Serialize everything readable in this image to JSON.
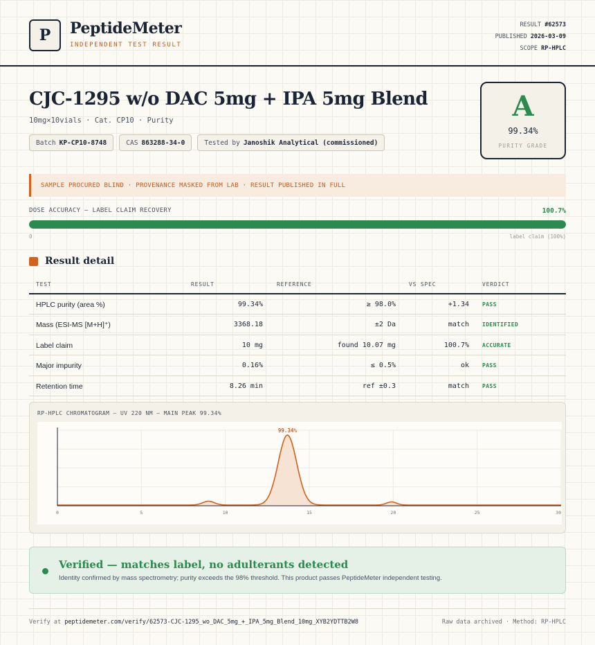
{
  "brand": {
    "logo_letter": "P",
    "name": "PeptideMeter",
    "tagline": "INDEPENDENT TEST RESULT"
  },
  "meta": {
    "result_label": "RESULT",
    "result_value": "#62573",
    "published_label": "PUBLISHED",
    "published_value": "2026-03-09",
    "scope_label": "SCOPE",
    "scope_value": "RP-HPLC"
  },
  "product": {
    "title": "CJC-1295 w/o DAC 5mg + IPA 5mg Blend",
    "subtitle": "10mg×10vials · Cat. CP10 · Purity",
    "chips": {
      "batch_label": "Batch",
      "batch_value": "KP-CP10-8748",
      "cas_label": "CAS",
      "cas_value": "863288-34-0",
      "tested_label": "Tested by",
      "tested_value": "Janoshik Analytical (commissioned)"
    }
  },
  "grade": {
    "letter": "A",
    "value": "99.34%",
    "label": "PURITY GRADE",
    "color": "#2b8a4e"
  },
  "notice": "SAMPLE PROCURED BLIND · PROVENANCE MASKED FROM LAB · RESULT PUBLISHED IN FULL",
  "dose": {
    "label": "DOSE ACCURACY — LABEL CLAIM RECOVERY",
    "value": "100.7%",
    "fill_fraction": 1.0,
    "min_label": "0",
    "max_label": "label claim (100%)"
  },
  "section_title": "Result detail",
  "table": {
    "headers": {
      "test": "TEST",
      "result": "RESULT",
      "reference": "REFERENCE",
      "vs_spec": "VS SPEC",
      "verdict": "VERDICT"
    },
    "rows": [
      {
        "test": "HPLC purity (area %)",
        "result": "99.34%",
        "reference": "≥ 98.0%",
        "vs_spec": "+1.34",
        "verdict": "PASS"
      },
      {
        "test": "Mass (ESI-MS [M+H]⁺)",
        "result": "3368.18",
        "reference": "±2 Da",
        "vs_spec": "match",
        "verdict": "IDENTIFIED"
      },
      {
        "test": "Label claim",
        "result": "10 mg",
        "reference": "found 10.07 mg",
        "vs_spec": "100.7%",
        "verdict": "ACCURATE"
      },
      {
        "test": "Major impurity",
        "result": "0.16%",
        "reference": "≤ 0.5%",
        "vs_spec": "ok",
        "verdict": "PASS"
      },
      {
        "test": "Retention time",
        "result": "8.26 min",
        "reference": "ref ±0.3",
        "vs_spec": "match",
        "verdict": "PASS"
      }
    ]
  },
  "chart_data": {
    "type": "line",
    "title": "RP-HPLC CHROMATOGRAM — UV 220 NM — MAIN PEAK 99.34%",
    "xlabel": "",
    "ylabel": "",
    "xlim": [
      0,
      30
    ],
    "ylim": [
      0,
      100
    ],
    "x_ticks": [
      "0",
      "5",
      "10",
      "15",
      "20",
      "25",
      "30"
    ],
    "peaks": [
      {
        "rt": 9.0,
        "height": 5.5,
        "width": 0.35
      },
      {
        "rt": 13.7,
        "height": 100,
        "width": 0.55,
        "label": "99.34%"
      },
      {
        "rt": 19.9,
        "height": 4.5,
        "width": 0.3
      }
    ],
    "baseline": 1.0,
    "line_color": "#d4601c",
    "fill_color": "#f6e3d4"
  },
  "verified": {
    "title": "Verified — matches label, no adulterants detected",
    "text": "Identity confirmed by mass spectrometry; purity exceeds the 98% threshold. This product passes PeptideMeter independent testing."
  },
  "footer": {
    "verify_label": "Verify at",
    "verify_url": "peptidemeter.com/verify/62573-CJC-1295_wo_DAC_5mg_+_IPA_5mg_Blend_10mg_XYB2YDTTB2W8",
    "right": "Raw data archived · Method: RP-HPLC"
  }
}
